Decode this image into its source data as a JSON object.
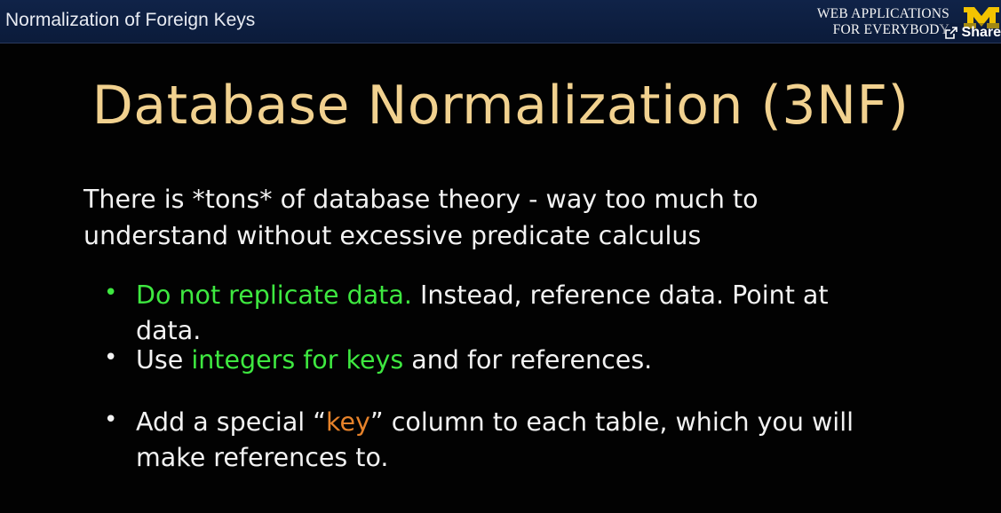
{
  "header": {
    "video_title": "Normalization of Foreign Keys",
    "brand_line1": "WEB APPLICATIONS",
    "brand_line2": "FOR EVERYBODY",
    "logo_icon": "university-m-logo-icon",
    "logo_color": "#f3c300",
    "share_label": "Share",
    "share_icon": "share-arrow-icon"
  },
  "slide": {
    "title": "Database Normalization (3NF)",
    "title_color": "#f1d18f",
    "intro": "There is *tons* of database theory - way too much to understand without excessive predicate calculus",
    "bullets": [
      {
        "marker": "•",
        "marker_color": "#3ee840",
        "highlight": "Do not replicate data.",
        "rest": " Instead, reference data. Point at data."
      },
      {
        "marker": "•",
        "marker_color": "#f2f2f2",
        "before": "Use ",
        "highlight": "integers for keys",
        "after": " and for references."
      },
      {
        "marker": "•",
        "marker_color": "#f2f2f2",
        "before": "Add a special “",
        "highlight": "key",
        "after": "” column to each table, which you will make references to."
      }
    ],
    "highlight_green": "#3ee840",
    "highlight_orange": "#e6822a"
  }
}
